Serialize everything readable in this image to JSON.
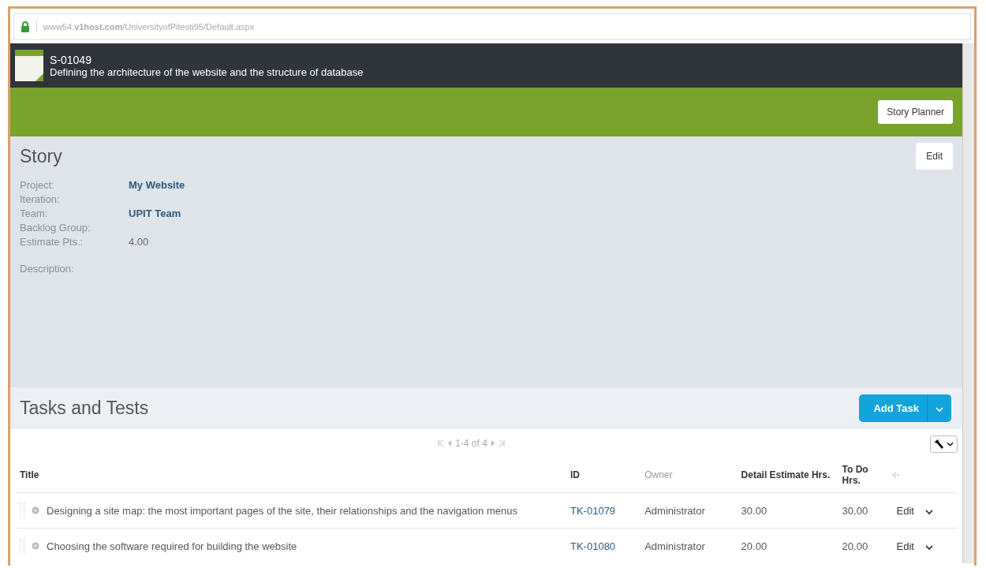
{
  "address_bar": {
    "url": "www54.**v1host.com**/UniversityofPitesti95/Default.aspx"
  },
  "header": {
    "id": "S-01049",
    "title": "Defining the architecture of the website and the structure of database"
  },
  "toolbar": {
    "button": "Story Planner"
  },
  "story": {
    "heading": "Story",
    "edit_button": "Edit",
    "fields": [
      {
        "label": "Project:",
        "value": "My Website"
      },
      {
        "label": "Iteration:"
      },
      {
        "label": "Team:",
        "value": "UPIT Team"
      },
      {
        "label": "Backlog Group:"
      },
      {
        "label": "Estimate Pts.:",
        "value": "4.00",
        "kind": "plain"
      }
    ],
    "description_label": "Description:"
  },
  "tasks": {
    "heading": "Tasks and Tests",
    "add_button": "Add Task",
    "pager": "1-4 of 4",
    "columns": [
      "Title",
      "ID",
      "Owner",
      "Detail Estimate Hrs.",
      "To Do Hrs."
    ],
    "rows": [
      {
        "title": "Designing a site map: the most important pages of the site, their relationships and the navigation menus",
        "id": "TK-01079",
        "owner": "Administrator",
        "detail": "30.00",
        "todo": "30.00",
        "action": "Edit"
      },
      {
        "title": "Choosing the software required for building the website",
        "id": "TK-01080",
        "owner": "Administrator",
        "detail": "20.00",
        "todo": "20.00",
        "action": "Edit"
      }
    ]
  }
}
